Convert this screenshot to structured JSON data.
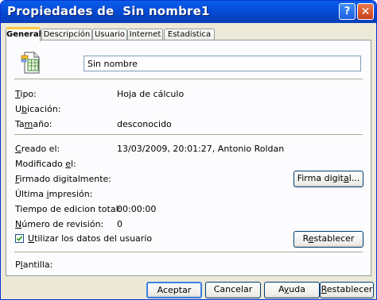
{
  "window": {
    "title": "Propiedades de  Sin nombre1",
    "help_symbol": "?",
    "close_symbol": "✕"
  },
  "tabs": [
    {
      "label": "General",
      "active": true
    },
    {
      "label": "Descripción",
      "active": false
    },
    {
      "label": "Usuario",
      "active": false
    },
    {
      "label": "Internet",
      "active": false
    },
    {
      "label": "Estadística",
      "active": false
    }
  ],
  "general": {
    "file_icon": "spreadsheet-document-icon",
    "file_name": "Sin nombre",
    "tipo": {
      "label_u": "T",
      "label_rest": "ipo:",
      "value": "Hoja de cálculo"
    },
    "ubicacion": {
      "label_pre": "U",
      "label_u": "b",
      "label_rest": "icación:"
    },
    "tamano": {
      "label_pre": "Ta",
      "label_u": "m",
      "label_rest": "año:",
      "value": "desconocido"
    },
    "creado": {
      "label_u": "C",
      "label_rest": "reado el:",
      "value": "13/03/2009, 20:01:27, Antonio Roldan"
    },
    "modificado": {
      "label_pre": "Modificado ",
      "label_u": "e",
      "label_rest": "l:"
    },
    "firmado": {
      "label_u": "F",
      "label_rest": "irmado digitalmente:"
    },
    "ultima": {
      "label_pre": "Última ",
      "label_u": "i",
      "label_rest": "mpresión:"
    },
    "tiempo": {
      "label": "Tiempo de edicion total:",
      "value": "00:00:00"
    },
    "revision": {
      "label_u": "N",
      "label_rest": "úmero de revisión:",
      "value": "0"
    },
    "usar_datos": {
      "label_u": "U",
      "label_rest": "tilizar los datos del usuario",
      "checked": true
    },
    "plantilla": {
      "label_pre": "P",
      "label_u": "l",
      "label_rest": "antilla:"
    },
    "firma_button": {
      "label_pre": "Firma digit",
      "label_u": "a",
      "label_rest": "l..."
    },
    "restablecer_button": {
      "label_pre": "R",
      "label_u": "e",
      "label_rest": "stablecer"
    }
  },
  "footer": {
    "aceptar": "Aceptar",
    "cancelar": "Cancelar",
    "ayuda": {
      "label_pre": "A",
      "label_u": "y",
      "label_rest": "uda"
    },
    "restablecer": {
      "label_u": "R",
      "label_rest": "establecer"
    }
  }
}
